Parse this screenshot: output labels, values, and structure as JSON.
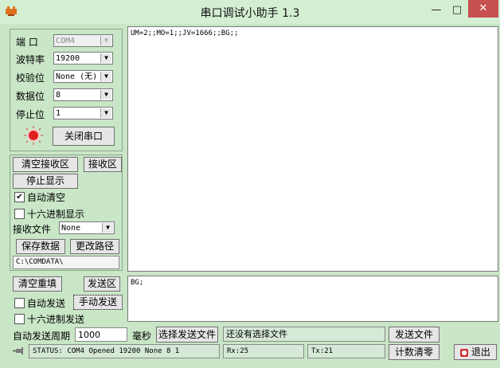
{
  "window": {
    "title": "串口调试小助手 1.3",
    "minimize_glyph": "—",
    "maximize_glyph": "□",
    "close_glyph": "✕"
  },
  "serial": {
    "port_label": "端 口",
    "port_value": "COM4",
    "baud_label": "波特率",
    "baud_value": "19200",
    "parity_label": "校验位",
    "parity_value": "None (无)",
    "databits_label": "数据位",
    "databits_value": "8",
    "stopbits_label": "停止位",
    "stopbits_value": "1",
    "close_port_label": "关闭串口"
  },
  "receive": {
    "clear_label": "清空接收区",
    "recv_area_label": "接收区",
    "stop_display_label": "停止显示",
    "auto_clear_label": "自动清空",
    "auto_clear_checked": "✔",
    "hex_display_label": "十六进制显示",
    "hex_display_checked": "",
    "file_label": "接收文件",
    "file_value": "None",
    "save_data_label": "保存数据",
    "change_path_label": "更改路径",
    "path_value": "C:\\COMDATA\\",
    "content": "UM=2;;MO=1;;JV=1666;;BG;;"
  },
  "send": {
    "clear_label": "清空重填",
    "send_area_label": "发送区",
    "auto_send_label": "自动发送",
    "auto_send_checked": "",
    "manual_send_label": "手动发送",
    "hex_send_label": "十六进制发送",
    "hex_send_checked": "",
    "content": "BG;",
    "period_label": "自动发送周期",
    "period_value": "1000",
    "period_unit": "毫秒",
    "select_file_label": "选择发送文件",
    "file_status": "还没有选择文件",
    "send_file_label": "发送文件",
    "clear_count_label": "计数清零",
    "exit_label": "退出"
  },
  "statusbar": {
    "status": "STATUS: COM4 Opened 19200 None  8 1",
    "rx": "Rx:25",
    "tx": "Tx:21"
  },
  "colors": {
    "panel_bg": "#c9e6c7",
    "led": "#e02020",
    "close_btn": "#c75050"
  }
}
